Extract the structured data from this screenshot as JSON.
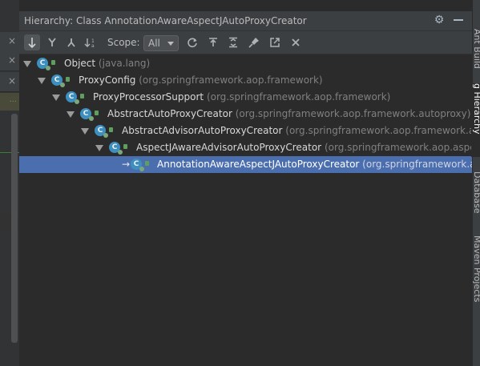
{
  "window": {
    "title": "Hierarchy:  Class AnnotationAwareAspectJAutoProxyCreator"
  },
  "toolbar": {
    "scope_label": "Scope:",
    "scope_value": "All"
  },
  "left_tabs": [
    "×",
    "×",
    "×",
    "×"
  ],
  "right_tabs": [
    "Ant Build",
    "g Hierarchy",
    "Database",
    "Maven Projects"
  ],
  "tree": [
    {
      "name": "Object",
      "package": "(java.lang)"
    },
    {
      "name": "ProxyConfig",
      "package": "(org.springframework.aop.framework)"
    },
    {
      "name": "ProxyProcessorSupport",
      "package": "(org.springframework.aop.framework)"
    },
    {
      "name": "AbstractAutoProxyCreator",
      "package": "(org.springframework.aop.framework.autoproxy)"
    },
    {
      "name": "AbstractAdvisorAutoProxyCreator",
      "package": "(org.springframework.aop.framework.au"
    },
    {
      "name": "AspectJAwareAdvisorAutoProxyCreator",
      "package": "(org.springframework.aop.aspec"
    },
    {
      "name": "AnnotationAwareAspectJAutoProxyCreator",
      "package": "(org.springframework.ao"
    }
  ],
  "colors": {
    "selection": "#4b6eaf",
    "class_icon": "#3d8fbf"
  }
}
